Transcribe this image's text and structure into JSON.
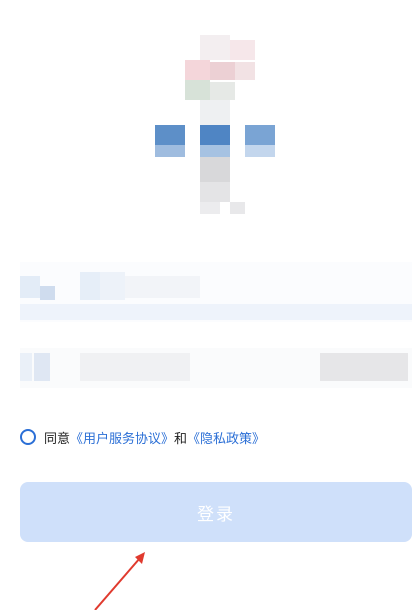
{
  "agreement": {
    "prefix": "同意",
    "terms_link": "《用户服务协议》",
    "conjunction": "和",
    "privacy_link": "《隐私政策》",
    "checked": false
  },
  "login_button": {
    "label": "登录",
    "state": "disabled"
  },
  "colors": {
    "accent": "#2b6fd6",
    "button_bg": "#cfe0fa",
    "annotation_arrow": "#e03a2e"
  },
  "icons": {
    "logo": "pixelated-app-logo-icon",
    "radio": "radio-unchecked-icon",
    "annotation": "red-arrow-annotation-icon"
  }
}
